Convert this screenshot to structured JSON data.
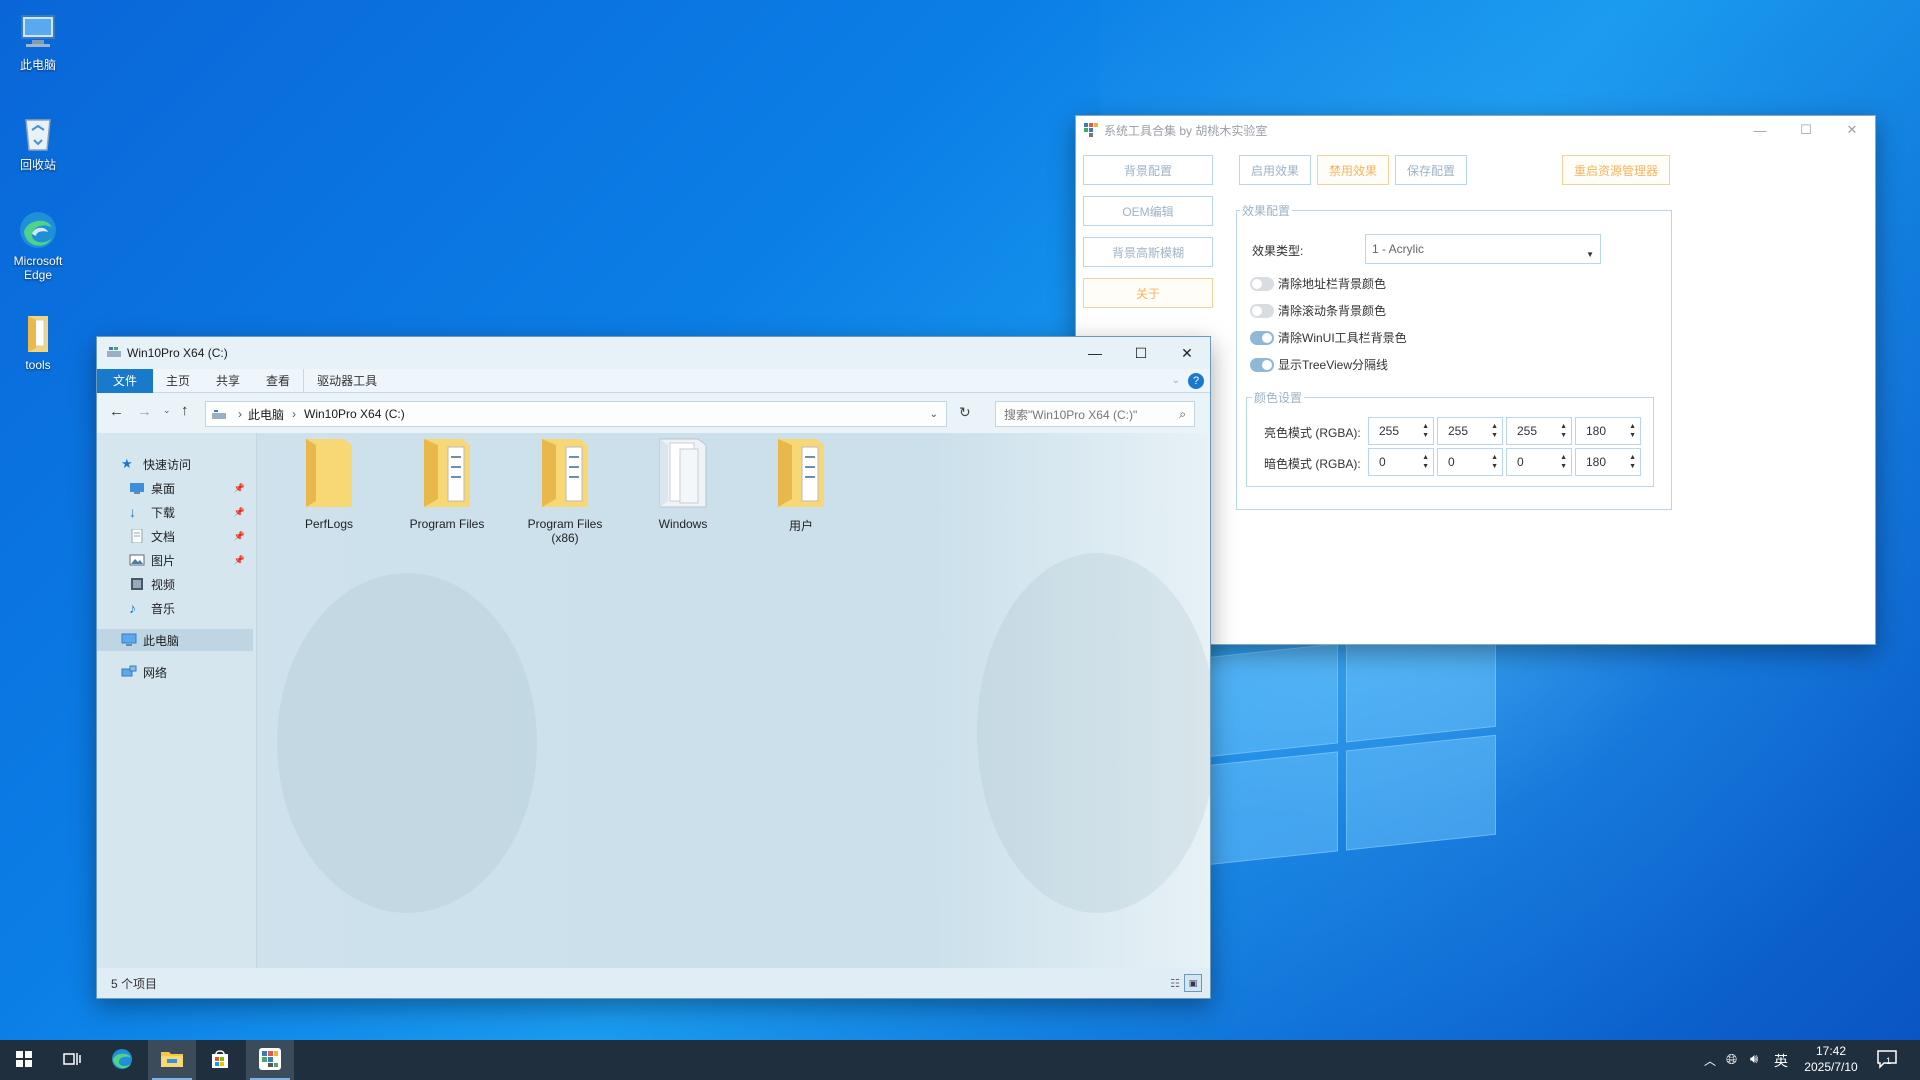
{
  "desktop": {
    "icons": [
      {
        "label": "此电脑",
        "icon": "computer-icon"
      },
      {
        "label": "回收站",
        "icon": "recycle-bin-icon"
      },
      {
        "label": "Microsoft Edge",
        "icon": "edge-icon"
      },
      {
        "label": "tools",
        "icon": "folder-icon"
      }
    ]
  },
  "tools_window": {
    "title": "系统工具合集 by 胡桃木实验室",
    "left_buttons": [
      "背景配置",
      "OEM编辑",
      "背景高斯模糊",
      "关于"
    ],
    "top_buttons": [
      "启用效果",
      "禁用效果",
      "保存配置",
      "重启资源管理器"
    ],
    "effect_group_label": "效果配置",
    "effect_type_label": "效果类型:",
    "effect_type_value": "1 - Acrylic",
    "toggles": [
      {
        "label": "清除地址栏背景颜色",
        "on": false
      },
      {
        "label": "清除滚动条背景颜色",
        "on": false
      },
      {
        "label": "清除WinUI工具栏背景色",
        "on": true
      },
      {
        "label": "显示TreeView分隔线",
        "on": true
      }
    ],
    "color_group_label": "颜色设置",
    "light_label": "亮色模式 (RGBA):",
    "light_values": [
      "255",
      "255",
      "255",
      "180"
    ],
    "dark_label": "暗色模式 (RGBA):",
    "dark_values": [
      "0",
      "0",
      "0",
      "180"
    ]
  },
  "explorer": {
    "title": "Win10Pro X64 (C:)",
    "ribbon_tabs": [
      "文件",
      "主页",
      "共享",
      "查看",
      "驱动器工具"
    ],
    "address_path": [
      "此电脑",
      "Win10Pro X64 (C:)"
    ],
    "search_placeholder": "搜索\"Win10Pro X64 (C:)\"",
    "nav": {
      "quick_access": "快速访问",
      "items": [
        "桌面",
        "下载",
        "文档",
        "图片",
        "视频",
        "音乐"
      ],
      "this_pc": "此电脑",
      "network": "网络"
    },
    "folders": [
      {
        "name": "PerfLogs",
        "variant": "plain"
      },
      {
        "name": "Program Files",
        "variant": "docs"
      },
      {
        "name": "Program Files (x86)",
        "variant": "docs"
      },
      {
        "name": "Windows",
        "variant": "open"
      },
      {
        "name": "用户",
        "variant": "docs"
      }
    ],
    "status": "5 个项目"
  },
  "taskbar": {
    "ime": "英",
    "time": "17:42",
    "date": "2025/7/10",
    "notification_count": "1"
  },
  "colors": {
    "accent": "#1979ca",
    "desktop_blue": "#0b7fe6",
    "taskbar": "#1f2f3e",
    "orange_button": "#f0b760",
    "blue_button_border": "#b9d6ef"
  }
}
